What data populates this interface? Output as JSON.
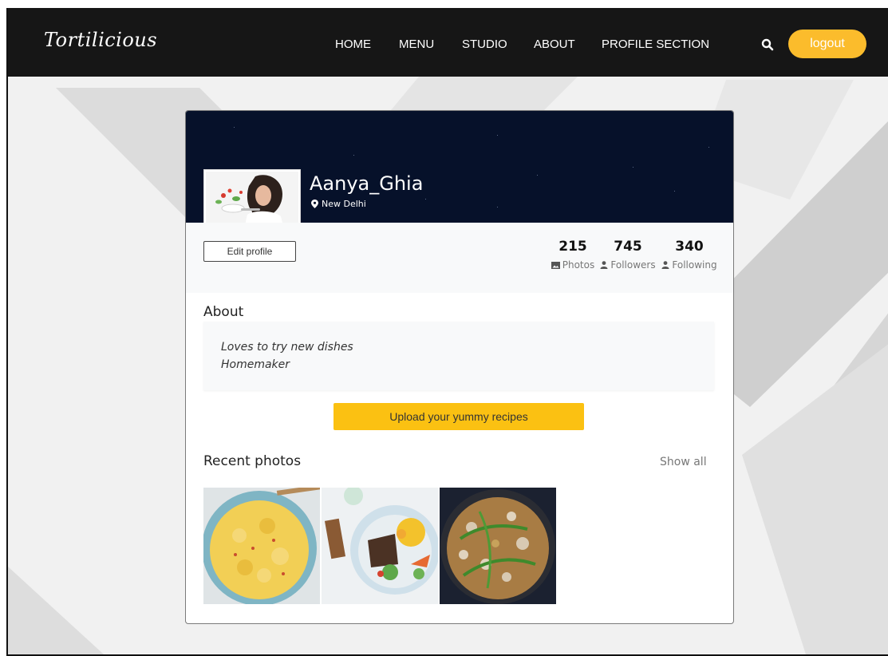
{
  "brand": {
    "logo": "Tortilicious"
  },
  "nav": {
    "items": [
      {
        "label": "HOME"
      },
      {
        "label": "MENU"
      },
      {
        "label": "STUDIO"
      },
      {
        "label": "ABOUT"
      },
      {
        "label": "PROFILE SECTION"
      }
    ],
    "search_icon": "search-icon",
    "logout_label": "logout"
  },
  "colors": {
    "accent": "#fbbc2c",
    "cover": "#06112a",
    "navbar": "#161616"
  },
  "profile": {
    "username": "Aanya_Ghia",
    "location": "New Delhi",
    "edit_label": "Edit profile",
    "stats": [
      {
        "value": "215",
        "label": "Photos",
        "icon": "photo-icon"
      },
      {
        "value": "745",
        "label": "Followers",
        "icon": "user-icon"
      },
      {
        "value": "340",
        "label": "Following",
        "icon": "user-icon"
      }
    ]
  },
  "about": {
    "title": "About",
    "lines": [
      "Loves to try new dishes",
      "Homemaker"
    ]
  },
  "upload_label": "Upload your yummy recipes",
  "recent": {
    "title": "Recent photos",
    "show_all": "Show all",
    "photos": [
      "pasta-photo",
      "breakfast-bowl-photo",
      "mushroom-omelette-photo"
    ]
  }
}
